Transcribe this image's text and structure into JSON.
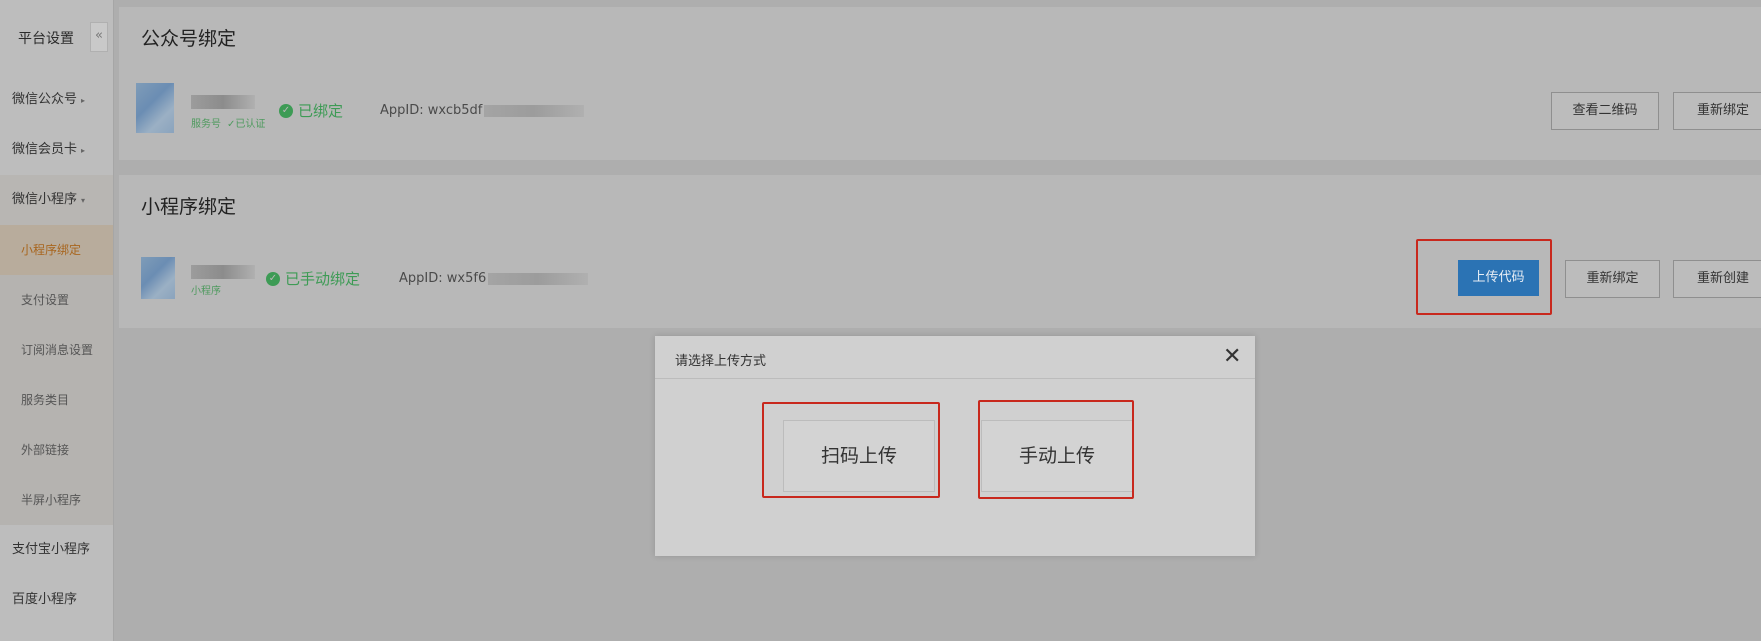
{
  "sidebar": {
    "title": "平台设置",
    "collapse_label": "«",
    "items": [
      {
        "label": "微信公众号",
        "caret": "▸"
      },
      {
        "label": "微信会员卡",
        "caret": "▸"
      },
      {
        "label": "微信小程序",
        "caret": "▾"
      }
    ],
    "sub_items": [
      {
        "label": "小程序绑定",
        "active": true
      },
      {
        "label": "支付设置"
      },
      {
        "label": "订阅消息设置"
      },
      {
        "label": "服务类目"
      },
      {
        "label": "外部链接"
      },
      {
        "label": "半屏小程序"
      }
    ],
    "bottom_items": [
      {
        "label": "支付宝小程序"
      },
      {
        "label": "百度小程序"
      }
    ]
  },
  "official_account": {
    "title": "公众号绑定",
    "tags": [
      "服务号",
      "✓已认证"
    ],
    "status": "已绑定",
    "appid_label": "AppID:",
    "appid_value": "wxcb5df",
    "qr_button": "查看二维码",
    "rebind_button": "重新绑定"
  },
  "mini_program": {
    "title": "小程序绑定",
    "tag": "小程序",
    "status": "已手动绑定",
    "appid_label": "AppID:",
    "appid_value": "wx5f6",
    "upload_button": "上传代码",
    "rebind_button": "重新绑定",
    "recreate_button": "重新创建"
  },
  "dialog": {
    "title": "请选择上传方式",
    "close": "✕",
    "scan_upload": "扫码上传",
    "manual_upload": "手动上传"
  },
  "colors": {
    "accent_blue": "#2b73b4",
    "status_green": "#3d9b55",
    "highlight_red": "#c8281d",
    "active_orange": "#a8661f"
  }
}
